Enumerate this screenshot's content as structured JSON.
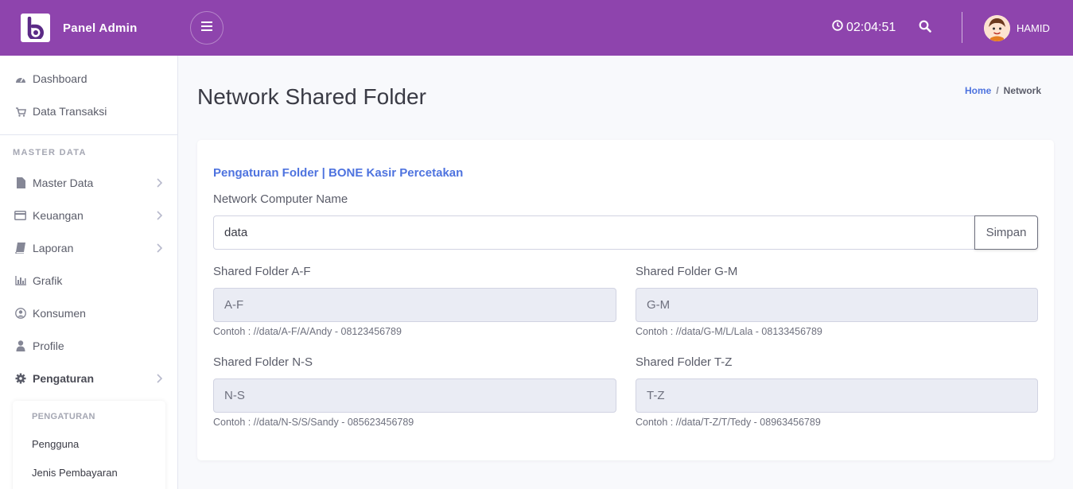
{
  "header": {
    "brand_name": "Panel Admin",
    "clock": "02:04:51",
    "username": "HAMID"
  },
  "colors": {
    "topbar": "#8e44ad",
    "accent": "#4e73df"
  },
  "sidebar": {
    "items": [
      {
        "label": "Dashboard",
        "icon": "dashboard-icon"
      },
      {
        "label": "Data Transaksi",
        "icon": "cart-icon"
      },
      {
        "label": "Master Data",
        "icon": "file-icon"
      },
      {
        "label": "Keuangan",
        "icon": "credit-card-icon"
      },
      {
        "label": "Laporan",
        "icon": "book-icon"
      },
      {
        "label": "Grafik",
        "icon": "bar-chart-icon"
      },
      {
        "label": "Konsumen",
        "icon": "user-circle-icon"
      },
      {
        "label": "Profile",
        "icon": "user-icon"
      },
      {
        "label": "Pengaturan",
        "icon": "gear-icon"
      }
    ],
    "heading": "MASTER DATA",
    "submenu": {
      "heading": "PENGATURAN",
      "items": [
        "Pengguna",
        "Jenis Pembayaran"
      ]
    }
  },
  "page": {
    "title": "Network Shared Folder",
    "breadcrumb": {
      "home": "Home",
      "separator": "/",
      "current": "Network"
    }
  },
  "form": {
    "card_title": "Pengaturan Folder | BONE Kasir Percetakan",
    "computer_name_label": "Network Computer Name",
    "computer_name_value": "data",
    "save_label": "Simpan",
    "folders": [
      {
        "label": "Shared Folder A-F",
        "value": "A-F",
        "hint": "Contoh : //data/A-F/A/Andy - 08123456789"
      },
      {
        "label": "Shared Folder G-M",
        "value": "G-M",
        "hint": "Contoh : //data/G-M/L/Lala - 08133456789"
      },
      {
        "label": "Shared Folder N-S",
        "value": "N-S",
        "hint": "Contoh : //data/N-S/S/Sandy - 085623456789"
      },
      {
        "label": "Shared Folder T-Z",
        "value": "T-Z",
        "hint": "Contoh : //data/T-Z/T/Tedy - 08963456789"
      }
    ]
  }
}
